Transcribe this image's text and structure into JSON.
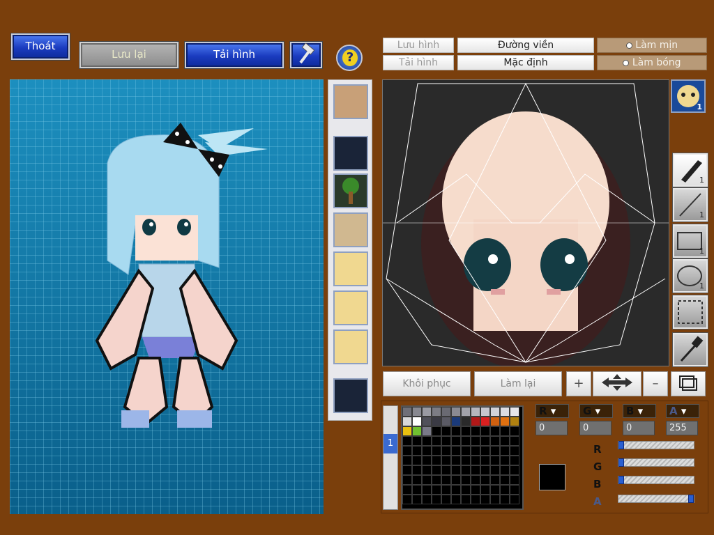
{
  "toolbar": {
    "exit_label": "Thoát",
    "save_label": "Lưu lại",
    "load_label": "Tải hình",
    "tool_icon": "hammer-icon",
    "help_icon": "help-question-icon"
  },
  "editor_toolbar": {
    "save_image": "Lưu hình",
    "load_image": "Tải hình",
    "outline": "Đường viền",
    "default": "Mặc định",
    "smooth": "Làm mịn",
    "shine": "Làm bóng"
  },
  "tools": [
    {
      "icon": "pen-icon",
      "count": "1"
    },
    {
      "icon": "line-icon",
      "count": "1"
    },
    {
      "icon": "rectangle-icon",
      "count": "1"
    },
    {
      "icon": "ellipse-icon",
      "count": "1"
    },
    {
      "icon": "selection-icon",
      "count": ""
    },
    {
      "icon": "eyedropper-icon",
      "count": ""
    }
  ],
  "face_slot_count": "1",
  "bottom_buttons": {
    "restore": "Khôi phục",
    "redo": "Làm lại"
  },
  "color": {
    "labels": [
      "R",
      "G",
      "B",
      "A"
    ],
    "values": [
      "0",
      "0",
      "0",
      "255"
    ],
    "slider_levels": [
      0,
      0,
      0,
      1.0
    ],
    "current_swatch": "#000000"
  },
  "palette": {
    "tab": "1",
    "row1": [
      "#707078",
      "#888890",
      "#9a9aa2",
      "#7c7c84",
      "#6a6a72",
      "#8a8a92",
      "#a2a2aa",
      "#b6b6be",
      "#c6c6ce",
      "#d2d2d8",
      "#dcdce2",
      "#e6e6ea"
    ],
    "row2": [
      "#d8d8d8",
      "#ffffff",
      "#50505a",
      "#3a3a44",
      "#5a5a64",
      "#1a3a7a",
      "#2a2a2a",
      "#b01818",
      "#d82020",
      "#d06010",
      "#e07010",
      "#b08010"
    ],
    "row3": [
      "#e8c010",
      "#70c030",
      "#7a7a88"
    ]
  }
}
